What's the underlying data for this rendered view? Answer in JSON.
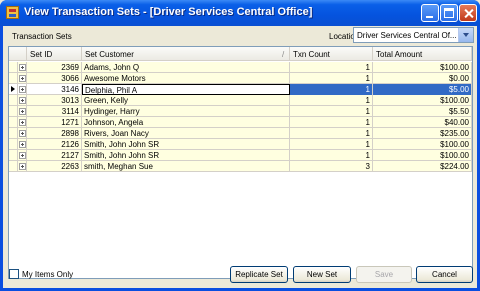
{
  "window": {
    "title": "View Transaction Sets - [Driver Services Central Office]"
  },
  "labels": {
    "transaction_sets": "Transaction Sets",
    "location": "Location"
  },
  "location": {
    "selected": "Driver Services Central Of..."
  },
  "grid": {
    "columns": [
      "Set ID",
      "Set Customer",
      "Txn Count",
      "Total Amount"
    ],
    "sort_indicator": "/",
    "selected_index": 2,
    "rows": [
      {
        "set_id": "2369",
        "customer": "Adams, John Q",
        "txn_count": "1",
        "total": "$100.00"
      },
      {
        "set_id": "3066",
        "customer": "Awesome Motors",
        "txn_count": "1",
        "total": "$0.00"
      },
      {
        "set_id": "3146",
        "customer": "Delphia, Phil A",
        "txn_count": "1",
        "total": "$5.00"
      },
      {
        "set_id": "3013",
        "customer": "Green, Kelly",
        "txn_count": "1",
        "total": "$100.00"
      },
      {
        "set_id": "3114",
        "customer": "Hydinger, Harry",
        "txn_count": "1",
        "total": "$5.50"
      },
      {
        "set_id": "1271",
        "customer": "Johnson, Angela",
        "txn_count": "1",
        "total": "$40.00"
      },
      {
        "set_id": "2898",
        "customer": "Rivers, Joan Nacy",
        "txn_count": "1",
        "total": "$235.00"
      },
      {
        "set_id": "2126",
        "customer": "Smith, John John SR",
        "txn_count": "1",
        "total": "$100.00"
      },
      {
        "set_id": "2127",
        "customer": "Smith, John John SR",
        "txn_count": "1",
        "total": "$100.00"
      },
      {
        "set_id": "2263",
        "customer": "smith, Meghan Sue",
        "txn_count": "3",
        "total": "$224.00"
      }
    ]
  },
  "my_items_only": {
    "label": "My Items Only",
    "checked": false
  },
  "buttons": {
    "replicate": "Replicate Set",
    "new": "New Set",
    "save": "Save",
    "cancel": "Cancel"
  }
}
